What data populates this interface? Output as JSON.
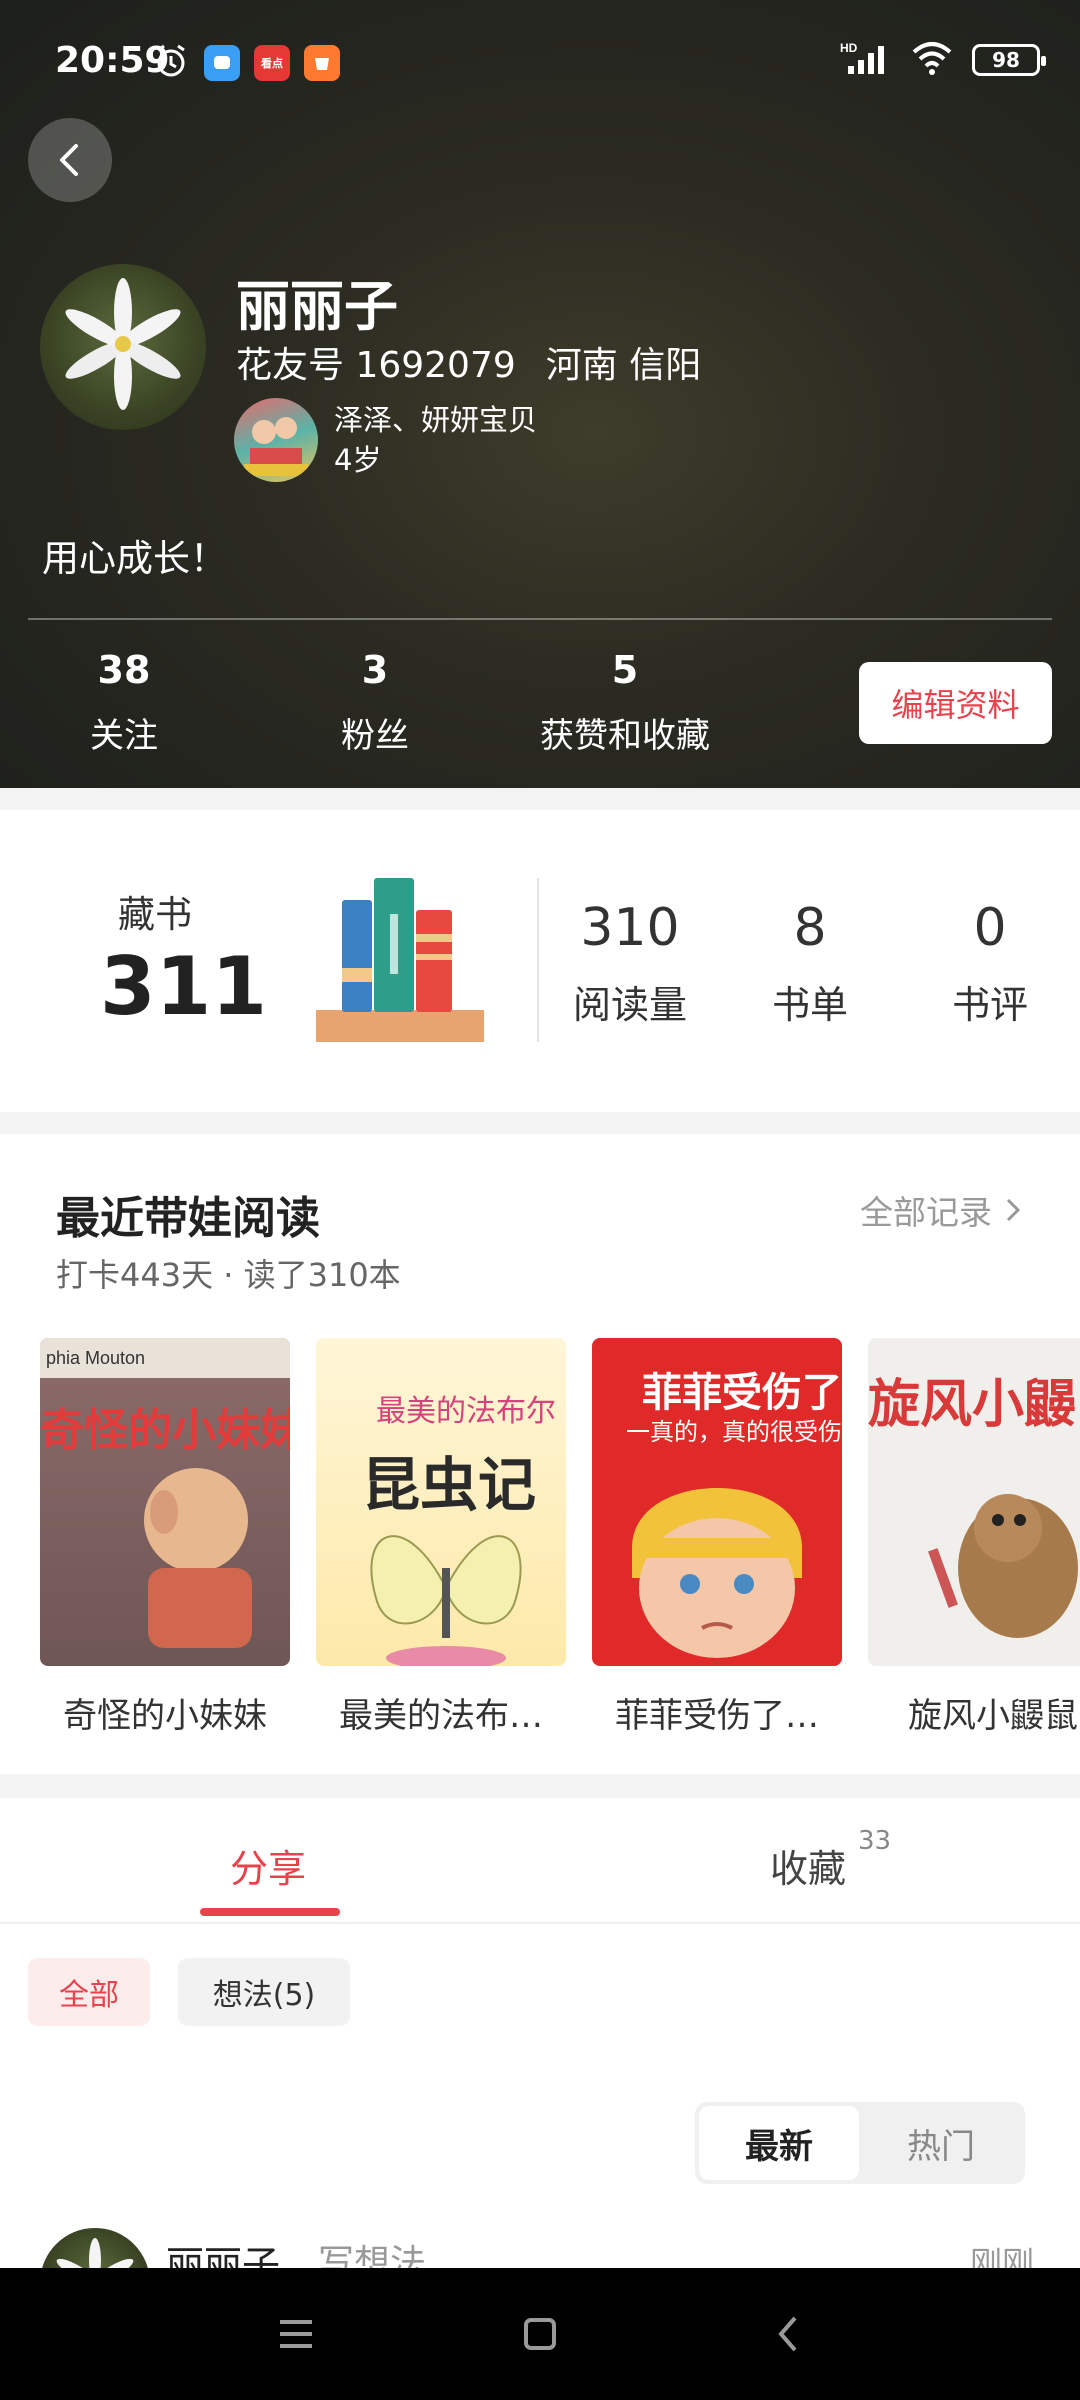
{
  "status": {
    "time": "20:59",
    "network": "HD",
    "battery": "98",
    "app_icon_label": "看点"
  },
  "profile": {
    "name": "丽丽子",
    "flower_id": "花友号 1692079",
    "location": "河南 信阳",
    "baby_name": "泽泽、妍妍宝贝",
    "baby_age": "4岁",
    "bio": "用心成长！",
    "stats": [
      {
        "value": "38",
        "label": "关注"
      },
      {
        "value": "3",
        "label": "粉丝"
      },
      {
        "value": "5",
        "label": "获赞和收藏"
      }
    ],
    "edit_label": "编辑资料"
  },
  "books": {
    "collection_label": "藏书",
    "collection_count": "311",
    "stats": [
      {
        "value": "310",
        "label": "阅读量"
      },
      {
        "value": "8",
        "label": "书单"
      },
      {
        "value": "0",
        "label": "书评"
      }
    ]
  },
  "recent": {
    "title": "最近带娃阅读",
    "all_records": "全部记录",
    "subtitle": "打卡443天 · 读了310本",
    "items": [
      {
        "title": "奇怪的小妹妹",
        "cover_text": "奇怪的小妹妹",
        "cover_top": "phia Mouton"
      },
      {
        "title": "最美的法布…",
        "cover_text": "昆虫记",
        "cover_sub": "最美的法布尔"
      },
      {
        "title": "菲菲受伤了…",
        "cover_text": "菲菲受伤了",
        "cover_sub": "一真的，真的很受伤"
      },
      {
        "title": "旋风小鼹鼠",
        "cover_text": "旋风小鼹"
      }
    ]
  },
  "tabs": {
    "share": "分享",
    "collect": "收藏",
    "collect_count": "33",
    "filters": [
      "全部",
      "想法(5)"
    ],
    "sort_new": "最新",
    "sort_hot": "热门"
  },
  "post": {
    "author": "丽丽子",
    "action": "写想法",
    "time": "刚刚"
  }
}
